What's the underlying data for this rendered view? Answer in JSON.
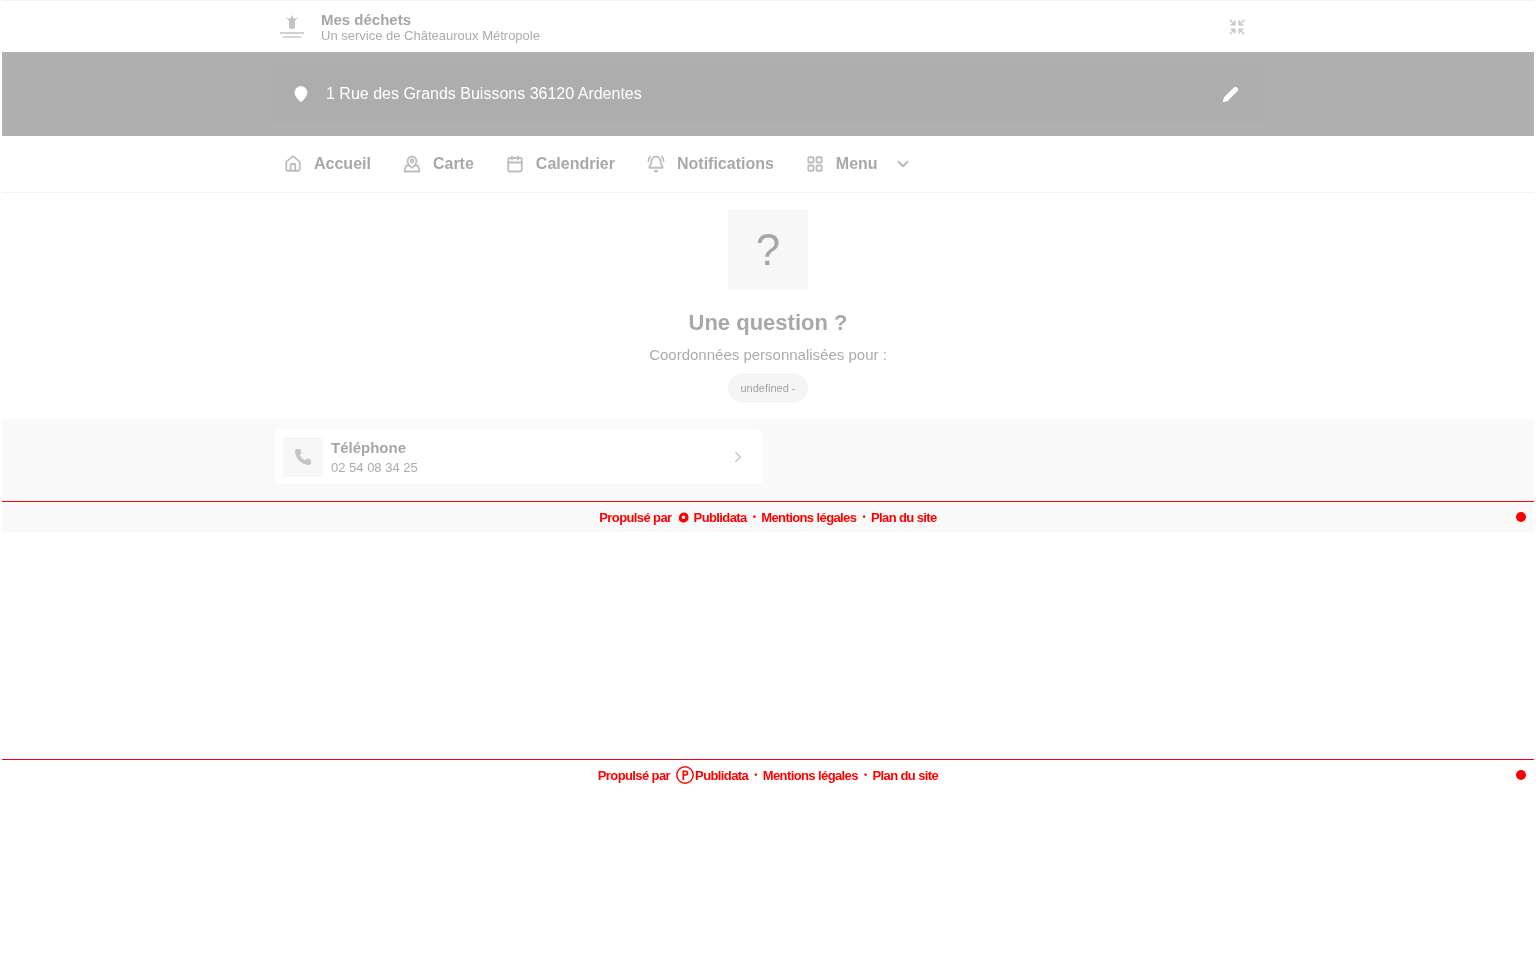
{
  "header": {
    "title": "Mes déchets",
    "subtitle": "Un service de Châteauroux Métropole"
  },
  "address_bar": {
    "value": "1 Rue des Grands Buissons 36120 Ardentes"
  },
  "nav": {
    "items": [
      {
        "label": "Accueil",
        "kind": "link"
      },
      {
        "label": "Carte",
        "kind": "link"
      },
      {
        "label": "Calendrier",
        "kind": "link"
      },
      {
        "label": "Notifications",
        "kind": "link"
      },
      {
        "label": "Menu",
        "kind": "dropdown"
      }
    ]
  },
  "contact": {
    "tile_glyph": "?",
    "title": "Une question ?",
    "subtitle": "Coordonnées personnalisées pour :",
    "tag": "undefined -"
  },
  "contacts": [
    {
      "title": "Téléphone",
      "value": "02 54 08 34 25"
    }
  ],
  "footers": [
    {
      "kind": "banded",
      "items": [
        {
          "kind": "text",
          "label": "Propulsé par"
        },
        {
          "kind": "brand",
          "label": "Publidata"
        },
        {
          "kind": "separator",
          "label": "•"
        },
        {
          "kind": "link",
          "label": "Mentions légales"
        },
        {
          "kind": "separator",
          "label": "•"
        },
        {
          "kind": "link",
          "label": "Plan du site"
        }
      ]
    },
    {
      "kind": "plain",
      "items": [
        {
          "kind": "text",
          "label": "Propulsé par"
        },
        {
          "kind": "brand",
          "label": "Publidata"
        },
        {
          "kind": "separator",
          "label": "•"
        },
        {
          "kind": "link",
          "label": "Mentions légales"
        },
        {
          "kind": "separator",
          "label": "•"
        },
        {
          "kind": "link",
          "label": "Plan du site"
        }
      ]
    }
  ]
}
